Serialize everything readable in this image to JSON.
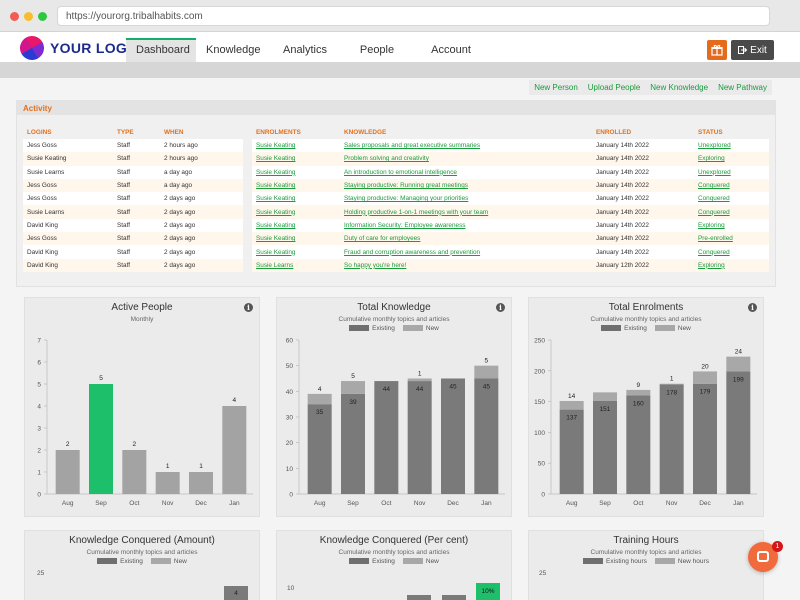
{
  "browser": {
    "url": "https://yourorg.tribalhabits.com"
  },
  "header": {
    "logo_text": "YOUR LOGO",
    "tabs": [
      {
        "label": "Dashboard"
      },
      {
        "label": "Knowledge"
      },
      {
        "label": "Analytics"
      },
      {
        "label": "People"
      },
      {
        "label": "Account"
      }
    ],
    "gift_icon": "gift-icon",
    "exit_label": "Exit",
    "exit_icon": "exit-icon"
  },
  "quick_links": [
    "New Person",
    "Upload People",
    "New Knowledge",
    "New Pathway"
  ],
  "activity": {
    "title": "Activity",
    "logins": {
      "columns": [
        "LOGINS",
        "TYPE",
        "WHEN"
      ],
      "rows": [
        [
          "Jess Goss",
          "Staff",
          "2 hours ago"
        ],
        [
          "Susie Keating",
          "Staff",
          "2 hours ago"
        ],
        [
          "Susie Learns",
          "Staff",
          "a day ago"
        ],
        [
          "Jess Goss",
          "Staff",
          "a day ago"
        ],
        [
          "Jess Goss",
          "Staff",
          "2 days ago"
        ],
        [
          "Susie Learns",
          "Staff",
          "2 days ago"
        ],
        [
          "David King",
          "Staff",
          "2 days ago"
        ],
        [
          "Jess Goss",
          "Staff",
          "2 days ago"
        ],
        [
          "David King",
          "Staff",
          "2 days ago"
        ],
        [
          "David King",
          "Staff",
          "2 days ago"
        ]
      ]
    },
    "enrolments": {
      "columns": [
        "ENROLMENTS",
        "KNOWLEDGE",
        "ENROLLED",
        "STATUS"
      ],
      "rows": [
        [
          "Susie Keating",
          "Sales proposals and great executive summaries",
          "January 14th 2022",
          "Unexplored"
        ],
        [
          "Susie Keating",
          "Problem solving and creativity",
          "January 14th 2022",
          "Exploring"
        ],
        [
          "Susie Keating",
          "An introduction to emotional intelligence",
          "January 14th 2022",
          "Unexplored"
        ],
        [
          "Susie Keating",
          "Staying productive: Running great meetings",
          "January 14th 2022",
          "Conquered"
        ],
        [
          "Susie Keating",
          "Staying productive: Managing your priorities",
          "January 14th 2022",
          "Conquered"
        ],
        [
          "Susie Keating",
          "Holding productive 1-on-1 meetings with your team",
          "January 14th 2022",
          "Conquered"
        ],
        [
          "Susie Keating",
          "Information Security: Employee awareness",
          "January 14th 2022",
          "Exploring"
        ],
        [
          "Susie Keating",
          "Duty of care for employees",
          "January 14th 2022",
          "Pre-enrolled"
        ],
        [
          "Susie Keating",
          "Fraud and corruption awareness and prevention",
          "January 14th 2022",
          "Conquered"
        ],
        [
          "Susie Learns",
          "So happy you're here!",
          "January 12th 2022",
          "Exploring"
        ]
      ]
    }
  },
  "colors": {
    "existing": "#7a7a7a",
    "new": "#a8a8a8",
    "single": "#a3a3a3",
    "highlight": "#1dbf6a"
  },
  "chart_data": [
    {
      "type": "bar",
      "title": "Active People",
      "subtitle": "Monthly",
      "categories": [
        "Aug",
        "Sep",
        "Oct",
        "Nov",
        "Dec",
        "Jan"
      ],
      "values": [
        2,
        5,
        2,
        1,
        1,
        4
      ],
      "highlight_index": 1,
      "ylim": [
        0,
        7
      ],
      "yticks": [
        0,
        1,
        2,
        3,
        4,
        5,
        6,
        7
      ]
    },
    {
      "type": "bar",
      "stacked": true,
      "title": "Total Knowledge",
      "subtitle": "Cumulative monthly topics and articles",
      "categories": [
        "Aug",
        "Sep",
        "Oct",
        "Nov",
        "Dec",
        "Jan"
      ],
      "series": [
        {
          "name": "Existing",
          "values": [
            35,
            39,
            44,
            44,
            45,
            45
          ]
        },
        {
          "name": "New",
          "values": [
            4,
            5,
            0,
            1,
            0,
            5
          ]
        }
      ],
      "labels_new": [
        "4",
        "5",
        "",
        "1",
        "",
        "5"
      ],
      "ylim": [
        0,
        60
      ],
      "yticks": [
        0,
        10,
        20,
        30,
        40,
        50,
        60
      ]
    },
    {
      "type": "bar",
      "stacked": true,
      "title": "Total Enrolments",
      "subtitle": "Cumulative monthly topics and articles",
      "categories": [
        "Aug",
        "Sep",
        "Oct",
        "Nov",
        "Dec",
        "Jan"
      ],
      "series": [
        {
          "name": "Existing",
          "values": [
            137,
            151,
            160,
            178,
            179,
            199
          ]
        },
        {
          "name": "New",
          "values": [
            14,
            14,
            9,
            1,
            20,
            24
          ]
        }
      ],
      "labels_new": [
        "14",
        "",
        "9",
        "1",
        "20",
        "24"
      ],
      "ylim": [
        0,
        250
      ],
      "yticks": [
        0,
        50,
        100,
        150,
        200,
        250
      ]
    },
    {
      "type": "bar",
      "stacked": true,
      "title": "Knowledge Conquered (Amount)",
      "subtitle": "Cumulative monthly topics and articles",
      "legend": [
        "Existing",
        "New"
      ],
      "yticks": [
        25
      ],
      "visible_labels": [
        "4"
      ]
    },
    {
      "type": "bar",
      "stacked": true,
      "title": "Knowledge Conquered (Per cent)",
      "subtitle": "Cumulative monthly topics and articles",
      "legend": [
        "Existing",
        "New"
      ],
      "yticks": [
        10
      ],
      "visible_labels": [
        "10%"
      ]
    },
    {
      "type": "bar",
      "stacked": true,
      "title": "Training Hours",
      "subtitle": "Cumulative monthly topics and articles",
      "legend": [
        "Existing hours",
        "New hours"
      ],
      "yticks": [
        25
      ]
    }
  ],
  "chat": {
    "badge": "1"
  }
}
